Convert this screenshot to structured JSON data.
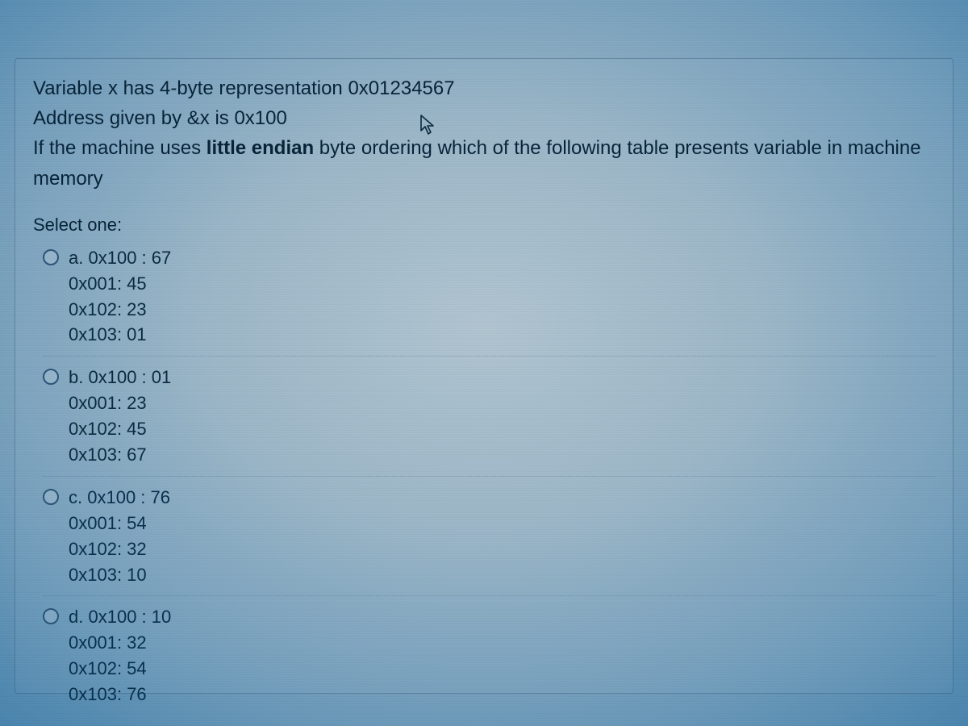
{
  "question": {
    "line1_pre": "Variable x has 4-byte representation ",
    "line1_val": "0x01234567",
    "line2_pre": "Address given by &x is ",
    "line2_val": "0x100",
    "line3_pre": "If the machine uses ",
    "line3_bold": "little endian",
    "line3_post": " byte ordering which of the following table presents variable in machine memory"
  },
  "select_label": "Select one:",
  "options": [
    {
      "letter": "a.",
      "rows": [
        "0x100 : 67",
        "0x001: 45",
        "0x102: 23",
        "0x103: 01"
      ]
    },
    {
      "letter": "b.",
      "rows": [
        "0x100 : 01",
        "0x001: 23",
        "0x102: 45",
        "0x103: 67"
      ]
    },
    {
      "letter": "c.",
      "rows": [
        "0x100 : 76",
        "0x001: 54",
        "0x102: 32",
        "0x103: 10"
      ]
    },
    {
      "letter": "d.",
      "rows": [
        "0x100 : 10",
        "0x001: 32",
        "0x102: 54",
        "0x103: 76"
      ]
    }
  ]
}
